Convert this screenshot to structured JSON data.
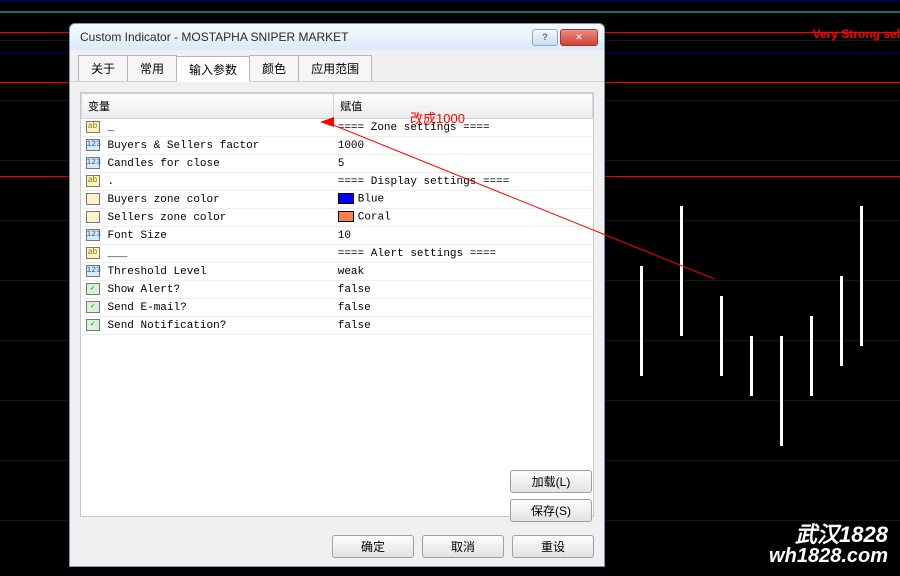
{
  "chart": {
    "topLabel": "Very Strong sel"
  },
  "dialog": {
    "title": "Custom Indicator - MOSTAPHA SNIPER MARKET",
    "tabs": [
      "关于",
      "常用",
      "输入参数",
      "颜色",
      "应用范围"
    ],
    "activeTabIndex": 2,
    "columns": {
      "variable": "变量",
      "value": "赋值"
    },
    "rows": [
      {
        "iconType": "ab",
        "name": "_",
        "valueType": "text",
        "value": "==== Zone settings ===="
      },
      {
        "iconType": "123",
        "name": "Buyers & Sellers factor",
        "valueType": "text",
        "value": "1000"
      },
      {
        "iconType": "123",
        "name": "Candles for close",
        "valueType": "text",
        "value": "5"
      },
      {
        "iconType": "ab",
        "name": ".",
        "valueType": "text",
        "value": "==== Display settings ===="
      },
      {
        "iconType": "color",
        "name": "Buyers zone color",
        "valueType": "color",
        "value": "Blue",
        "swatch": "#0000ff"
      },
      {
        "iconType": "color",
        "name": "Sellers zone color",
        "valueType": "color",
        "value": "Coral",
        "swatch": "#ff7f50"
      },
      {
        "iconType": "123",
        "name": "Font Size",
        "valueType": "text",
        "value": "10"
      },
      {
        "iconType": "ab",
        "name": "___",
        "valueType": "text",
        "value": "==== Alert settings ===="
      },
      {
        "iconType": "123",
        "name": "Threshold Level",
        "valueType": "text",
        "value": "weak"
      },
      {
        "iconType": "bool",
        "name": "Show Alert?",
        "valueType": "text",
        "value": "false"
      },
      {
        "iconType": "bool",
        "name": "Send E-mail?",
        "valueType": "text",
        "value": "false"
      },
      {
        "iconType": "bool",
        "name": "Send Notification?",
        "valueType": "text",
        "value": "false"
      }
    ],
    "buttons": {
      "load": "加载(L)",
      "save": "保存(S)",
      "ok": "确定",
      "cancel": "取消",
      "reset": "重设"
    }
  },
  "annotation": {
    "text": "改成1000"
  },
  "watermark": {
    "line1": "武汉1828",
    "line2": "wh1828.com"
  }
}
